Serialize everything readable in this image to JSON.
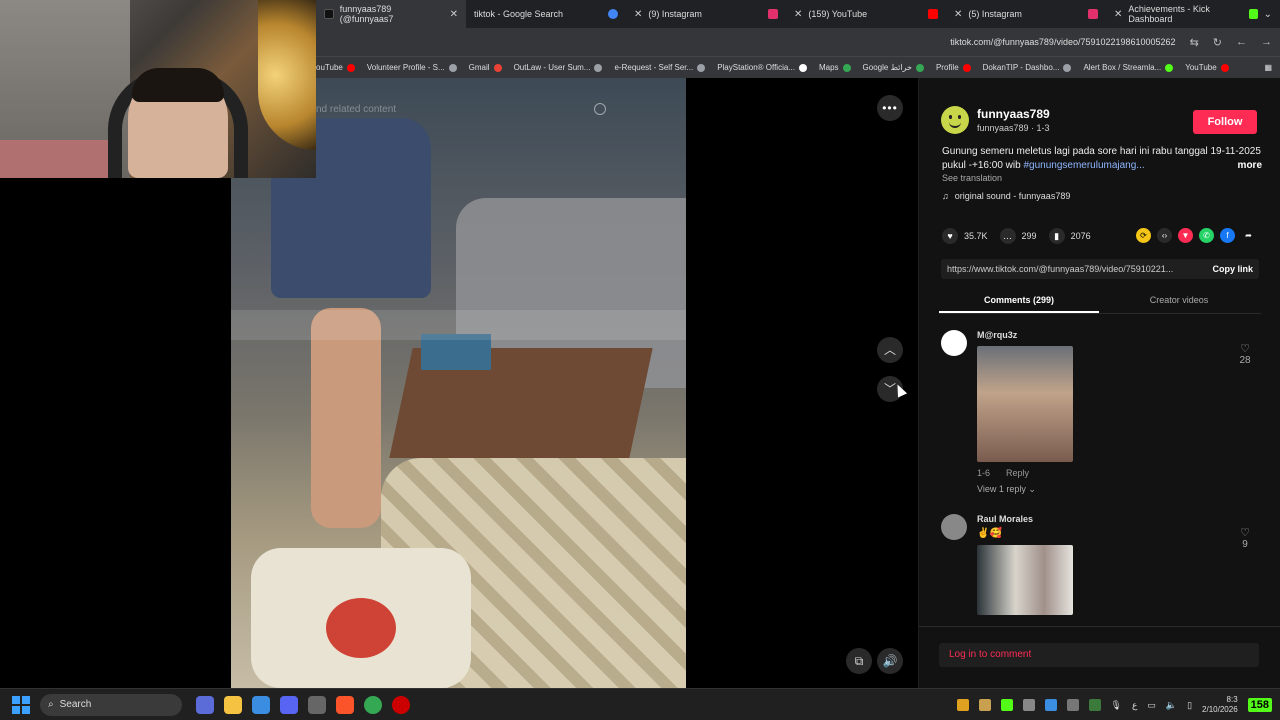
{
  "browser": {
    "tabs": [
      {
        "label": "funnyaas789 (@funnyaas7",
        "active": true,
        "color": "#111111"
      },
      {
        "label": "tiktok - Google Search",
        "active": false,
        "color": "#4285f4"
      },
      {
        "label": "(9) Instagram",
        "active": false,
        "color": "#e1306c"
      },
      {
        "label": "(159) YouTube",
        "active": false,
        "color": "#ff0000"
      },
      {
        "label": "(5) Instagram",
        "active": false,
        "color": "#e1306c"
      },
      {
        "label": "Achievements - Kick Dashboard",
        "active": false,
        "color": "#53fc18"
      }
    ],
    "url": "tiktok.com/@funnyaas789/video/7591022198610005262",
    "bookmarks": [
      {
        "label": "ouTube",
        "color": "#ff0000"
      },
      {
        "label": "Volunteer Profile - S...",
        "color": "#9aa0a6"
      },
      {
        "label": "Gmail",
        "color": "#ea4335"
      },
      {
        "label": "OutLaw - User Sum...",
        "color": "#9aa0a6"
      },
      {
        "label": "e-Request - Self Ser...",
        "color": "#9aa0a6"
      },
      {
        "label": "PlayStation® Officia...",
        "color": "#ffffff"
      },
      {
        "label": "Maps",
        "color": "#34a853"
      },
      {
        "label": "Google خرائط",
        "color": "#34a853"
      },
      {
        "label": "Profile",
        "color": "#ff0000"
      },
      {
        "label": "DokanTIP - Dashbo...",
        "color": "#9aa0a6"
      },
      {
        "label": "Alert Box / Streamla...",
        "color": "#53fc18"
      },
      {
        "label": "YouTube",
        "color": "#ff0000"
      }
    ]
  },
  "video": {
    "search_placeholder": "nd related content"
  },
  "panel": {
    "author_name": "funnyaas789",
    "author_sub": "funnyaas789 · 1-3",
    "follow_label": "Follow",
    "description": "Gunung semeru meletus lagi pada sore hari ini rabu tanggal 19-11-2025 pukul -+16:00 wib",
    "hashtag": "#gunungsemerulumajang...",
    "more_label": "more",
    "see_translation": "See translation",
    "sound": "original sound - funnyaas789",
    "likes": "35.7K",
    "comments_count": "299",
    "saves": "2076",
    "link": "https://www.tiktok.com/@funnyaas789/video/75910221...",
    "copy_link": "Copy link",
    "tab_comments": "Comments (299)",
    "tab_creator": "Creator videos",
    "comments": [
      {
        "name": "M@rqu3z",
        "meta_date": "1-6",
        "reply": "Reply",
        "view_replies": "View 1 reply ⌄",
        "likes": "28"
      },
      {
        "name": "Raul Morales",
        "emoji": "✌️🥰",
        "likes": "9"
      }
    ],
    "login": "Log in to comment"
  },
  "taskbar": {
    "search_label": "Search",
    "clock_time": "8:3",
    "clock_date": "2/10/2026",
    "badge": "158"
  }
}
